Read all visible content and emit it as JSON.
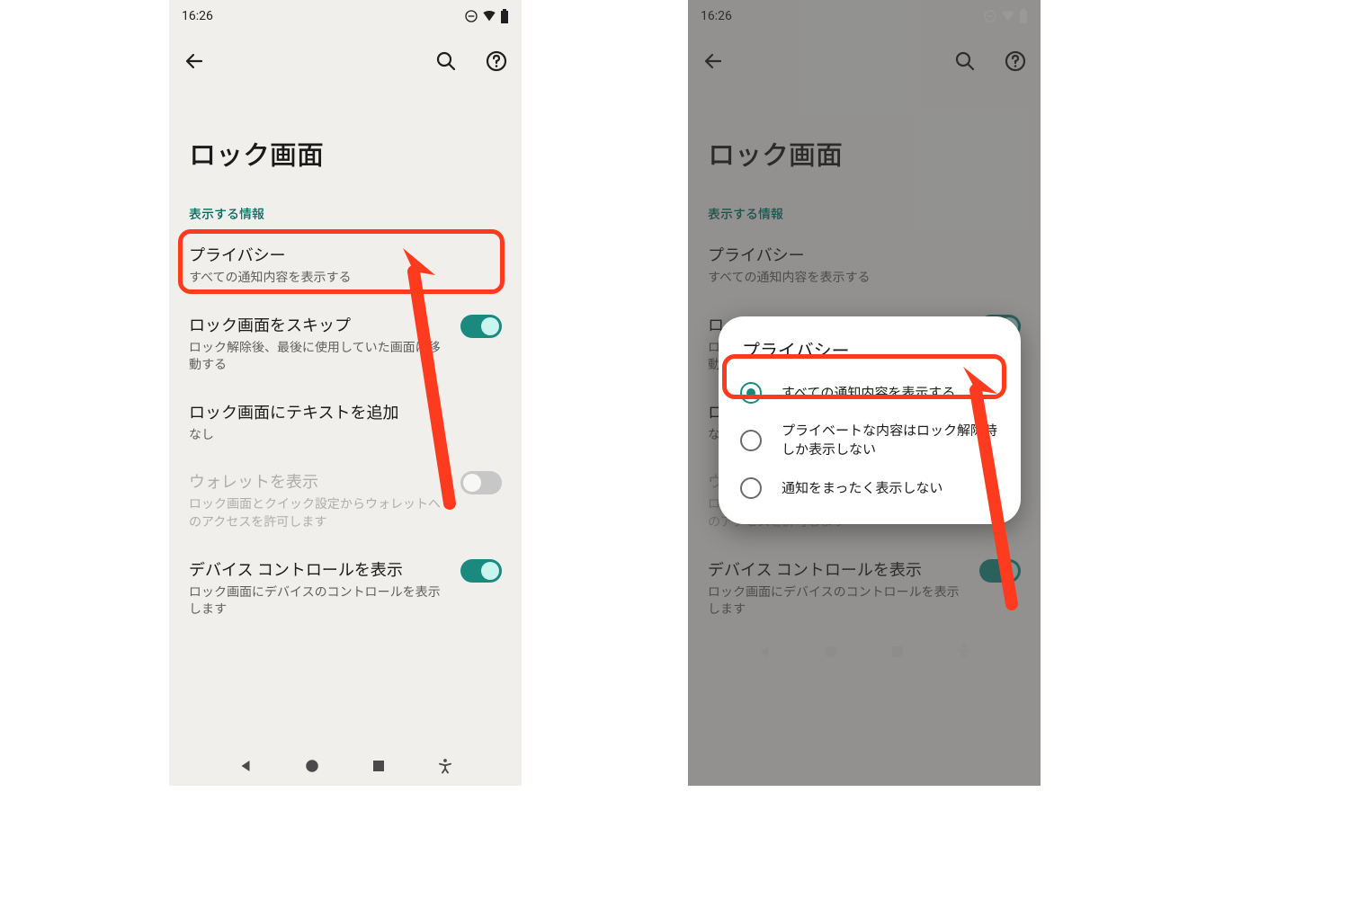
{
  "status": {
    "time": "16:26"
  },
  "title": "ロック画面",
  "section_header": "表示する情報",
  "rows": {
    "privacy": {
      "title": "プライバシー",
      "sub": "すべての通知内容を表示する"
    },
    "skip": {
      "title": "ロック画面をスキップ",
      "sub": "ロック解除後、最後に使用していた画面に移動する"
    },
    "text": {
      "title": "ロック画面にテキストを追加",
      "sub": "なし"
    },
    "wallet": {
      "title": "ウォレットを表示",
      "sub": "ロック画面とクイック設定からウォレットへのアクセスを許可します"
    },
    "device": {
      "title": "デバイス コントロールを表示",
      "sub": "ロック画面にデバイスのコントロールを表示します"
    }
  },
  "dialog": {
    "title": "プライバシー",
    "opt1": "すべての通知内容を表示する",
    "opt2": "プライベートな内容はロック解除時しか表示しない",
    "opt3": "通知をまったく表示しない"
  }
}
